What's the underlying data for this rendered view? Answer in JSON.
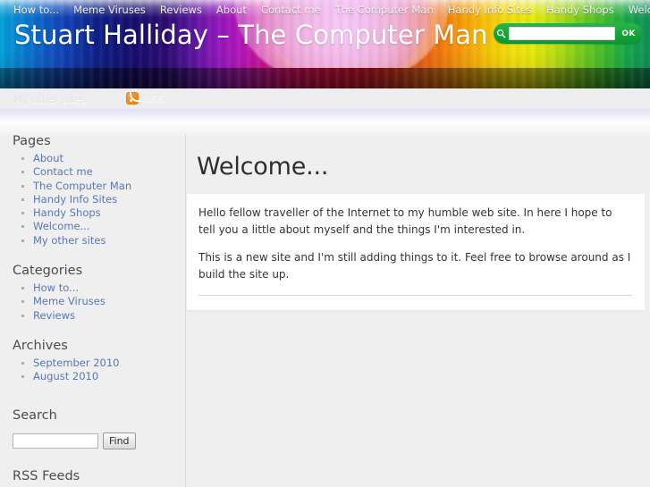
{
  "site": {
    "title": "Stuart Halliday – The Computer Man"
  },
  "header_search": {
    "icon": "search-icon",
    "value": "",
    "placeholder": "",
    "submit_label": "OK",
    "pill_color": "#16a23a"
  },
  "nav": {
    "primary": [
      {
        "label": "How to..."
      },
      {
        "label": "Meme Viruses"
      },
      {
        "label": "Reviews"
      },
      {
        "label": "About"
      },
      {
        "label": "Contact me"
      },
      {
        "label": "The Computer Man"
      },
      {
        "label": "Handy Info Sites"
      },
      {
        "label": "Handy Shops"
      },
      {
        "label": "Welcome..."
      }
    ],
    "secondary": {
      "label": "My other sites",
      "rss_label": "RSS",
      "rss_icon": "rss-icon"
    }
  },
  "sidebar": {
    "pages": {
      "heading": "Pages",
      "items": [
        {
          "label": "About"
        },
        {
          "label": "Contact me"
        },
        {
          "label": "The Computer Man"
        },
        {
          "label": "Handy Info Sites"
        },
        {
          "label": "Handy Shops"
        },
        {
          "label": "Welcome..."
        },
        {
          "label": "My other sites"
        }
      ]
    },
    "categories": {
      "heading": "Categories",
      "items": [
        {
          "label": "How to..."
        },
        {
          "label": "Meme Viruses"
        },
        {
          "label": "Reviews"
        }
      ]
    },
    "archives": {
      "heading": "Archives",
      "items": [
        {
          "label": "September 2010"
        },
        {
          "label": "August 2010"
        }
      ]
    },
    "search": {
      "heading": "Search",
      "value": "",
      "placeholder": "",
      "button_label": "Find"
    },
    "rss_feeds": {
      "heading": "RSS Feeds"
    }
  },
  "main": {
    "title": "Welcome...",
    "paragraphs": [
      "Hello fellow traveller of the Internet to my humble web site. In here I hope to tell you a little about myself and the things I'm interested in.",
      "This is a new site and I'm still adding things to it. Feel free to browse around as I build the site up."
    ]
  },
  "colors": {
    "link": "#5878b4",
    "body_bg": "#efefef",
    "card_bg": "#ffffff",
    "heading": "#4c4c4c"
  }
}
